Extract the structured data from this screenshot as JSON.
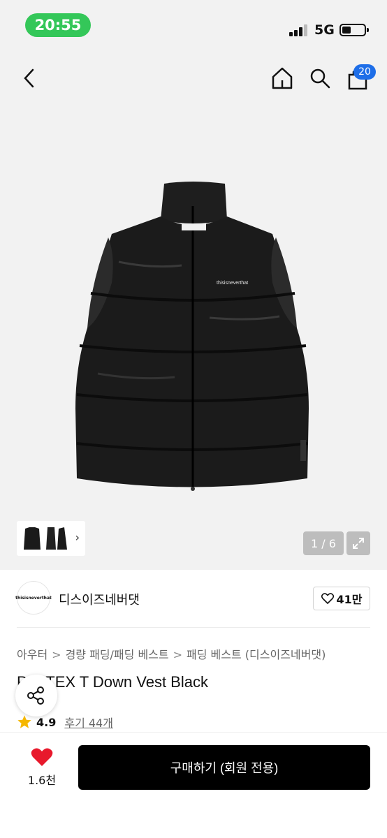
{
  "status_bar": {
    "time": "20:55",
    "network": "5G"
  },
  "top_nav": {
    "cart_badge": "20",
    "icons": [
      "back-arrow-icon",
      "home-icon",
      "search-icon",
      "shopping-bag-icon"
    ]
  },
  "gallery": {
    "counter": "1 / 6",
    "logo_text": "thisisneverthat",
    "expand_icon": "expand-icon"
  },
  "brand": {
    "name": "디스이즈네버댓",
    "logo_text": "thisisneverthat",
    "likes": "41만"
  },
  "breadcrumb": [
    "아우터",
    "경량 패딩/패딩 베스트",
    "패딩 베스트 (디스이즈네버댓)"
  ],
  "product": {
    "title": "P■■TEX T Down Vest Black"
  },
  "rating": {
    "score": "4.9",
    "reviews": "후기 44개"
  },
  "bottom_bar": {
    "wish_count": "1.6천",
    "buy_label": "구매하기 (회원 전용)"
  },
  "colors": {
    "status_green": "#34c759",
    "badge_blue": "#1e6ee8",
    "heart_red": "#e8192c",
    "star_yellow": "#f5b700"
  }
}
